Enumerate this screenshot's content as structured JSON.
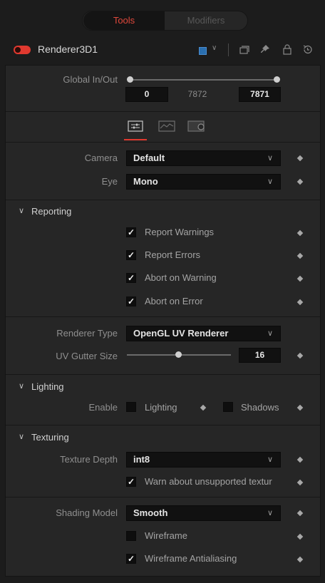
{
  "tabs": {
    "tools": "Tools",
    "modifiers": "Modifiers"
  },
  "node": {
    "name": "Renderer3D1",
    "swatch_color": "#2a6fb0"
  },
  "global": {
    "label": "Global In/Out",
    "in": "0",
    "mid": "7872",
    "out": "7871"
  },
  "camera": {
    "label": "Camera",
    "value": "Default"
  },
  "eye": {
    "label": "Eye",
    "value": "Mono"
  },
  "reporting": {
    "title": "Reporting",
    "items": [
      "Report Warnings",
      "Report Errors",
      "Abort on Warning",
      "Abort on Error"
    ]
  },
  "renderer_type": {
    "label": "Renderer Type",
    "value": "OpenGL UV Renderer"
  },
  "uv_gutter": {
    "label": "UV Gutter Size",
    "value": "16"
  },
  "lighting": {
    "title": "Lighting",
    "enable_label": "Enable",
    "lighting_label": "Lighting",
    "shadows_label": "Shadows"
  },
  "texturing": {
    "title": "Texturing",
    "depth_label": "Texture Depth",
    "depth_value": "int8",
    "warn_label": "Warn about unsupported textur"
  },
  "shading": {
    "label": "Shading Model",
    "value": "Smooth",
    "wireframe": "Wireframe",
    "wireframe_aa": "Wireframe Antialiasing"
  },
  "colors": {
    "accent": "#e0392f",
    "panel": "#262626",
    "background": "#1c1c1c"
  }
}
